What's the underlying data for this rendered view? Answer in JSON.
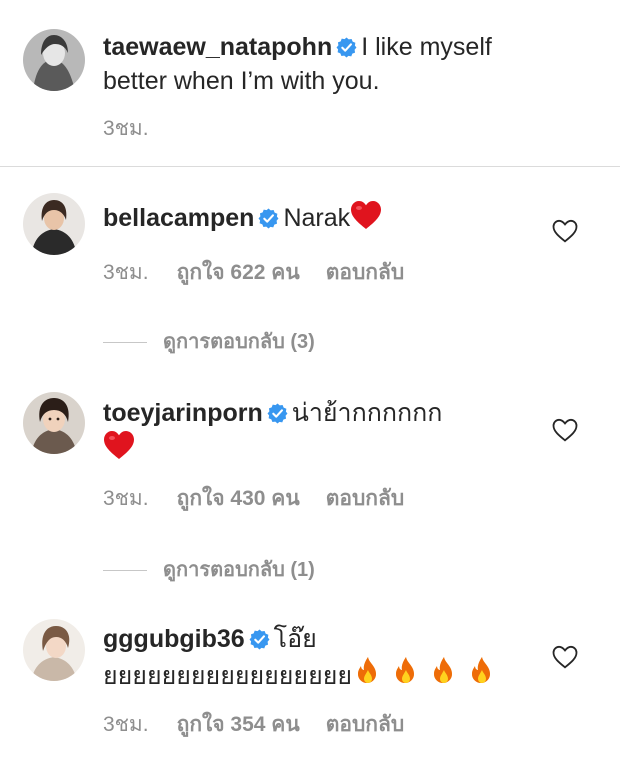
{
  "caption": {
    "username": "taewaew_natapohn",
    "text": "I like myself better when I’m with you.",
    "time": "3ชม."
  },
  "comments": [
    {
      "username": "bellacampen",
      "text": "Narak",
      "emoji": "red-heart",
      "time": "3ชม.",
      "likes": "ถูกใจ 622 คน",
      "reply_label": "ตอบกลับ",
      "view_replies": "ดูการตอบกลับ (3)"
    },
    {
      "username": "toeyjarinporn",
      "text": "น่าย้ากกกกกก",
      "emoji": "red-heart",
      "time": "3ชม.",
      "likes": "ถูกใจ 430 คน",
      "reply_label": "ตอบกลับ",
      "view_replies": "ดูการตอบกลับ (1)"
    },
    {
      "username": "gggubgib36",
      "text": "โอ๊ย",
      "text2": "ยยยยยยยยยยยยยยยยย",
      "emoji": "fire",
      "time": "3ชม.",
      "likes": "ถูกใจ 354 คน",
      "reply_label": "ตอบกลับ"
    }
  ],
  "colors": {
    "verified": "#3897f0",
    "text": "#262626",
    "meta": "#8e8e8e",
    "heart_emoji": "#e0141e",
    "fire": "#ff7a00"
  },
  "icons": {
    "verified": "verified-badge-icon",
    "like": "heart-outline-icon"
  }
}
